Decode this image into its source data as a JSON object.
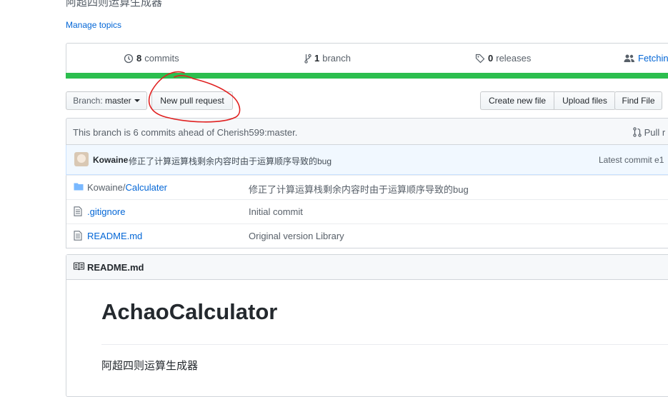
{
  "repo": {
    "description": "阿超四则运算生成器",
    "manage_topics": "Manage topics"
  },
  "numbers": {
    "commits_count": "8",
    "commits_label": "commits",
    "branch_count": "1",
    "branch_label": "branch",
    "releases_count": "0",
    "releases_label": "releases",
    "contributors_label": "Fetchin"
  },
  "toolbar": {
    "branch_prefix": "Branch:",
    "branch_name": "master",
    "new_pull_request": "New pull request",
    "create_new_file": "Create new file",
    "upload_files": "Upload files",
    "find_file": "Find File"
  },
  "ahead_notice": {
    "text": "This branch is 6 commits ahead of Cherish599:master.",
    "pull_request": "Pull r"
  },
  "latest_commit": {
    "author": "Kowaine",
    "message": "修正了计算运算栈剩余内容时由于运算顺序导致的bug",
    "label": "Latest commit e1"
  },
  "files": [
    {
      "type": "folder",
      "prefix": "Kowaine/",
      "name": "Calculater",
      "commit_message": "修正了计算运算栈剩余内容时由于运算顺序导致的bug"
    },
    {
      "type": "file",
      "prefix": "",
      "name": ".gitignore",
      "commit_message": "Initial commit"
    },
    {
      "type": "file",
      "prefix": "",
      "name": "README.md",
      "commit_message": "Original version Library"
    }
  ],
  "readme": {
    "filename": "README.md",
    "heading": "AchaoCalculator",
    "paragraph": "阿超四则运算生成器"
  },
  "colors": {
    "link": "#0366d6",
    "language_bar": "#2cbe4e",
    "annotation": "#e02020"
  }
}
